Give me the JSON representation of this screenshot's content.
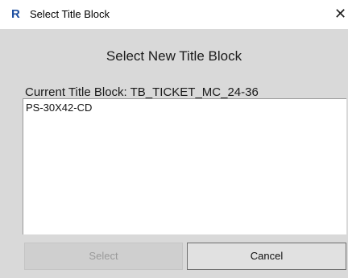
{
  "window": {
    "app_icon_glyph": "R",
    "title": "Select Title Block",
    "close_glyph": "✕"
  },
  "dialog": {
    "heading": "Select New Title Block",
    "current_title_block_label": "Current Title Block: TB_TICKET_MC_24-36",
    "list_items": [
      "PS-30X42-CD"
    ],
    "buttons": {
      "select": "Select",
      "cancel": "Cancel"
    }
  },
  "colors": {
    "app_icon": "#1e4fa0",
    "dialog_background": "#d9d9d9",
    "list_background": "#ffffff"
  }
}
